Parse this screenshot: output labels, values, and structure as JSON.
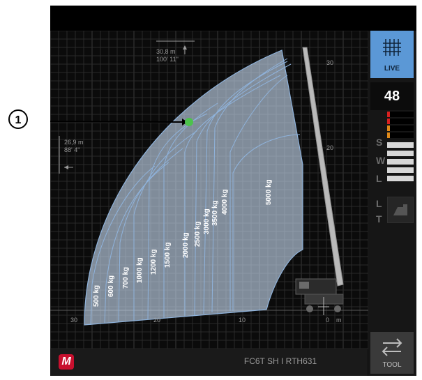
{
  "callout": {
    "number": "1"
  },
  "top_dim": {
    "metric": "30,8 m",
    "imperial": "100' 11\""
  },
  "side_dim": {
    "metric": "26,9 m",
    "imperial": "88' 4\""
  },
  "axis": {
    "x_labels": [
      "30",
      "20",
      "10",
      "0",
      "m"
    ],
    "y_labels": [
      "30",
      "20"
    ]
  },
  "load_zones": [
    {
      "label": "500 kg",
      "value_kg": 500
    },
    {
      "label": "600 kg",
      "value_kg": 600
    },
    {
      "label": "700 kg",
      "value_kg": 700
    },
    {
      "label": "1000 kg",
      "value_kg": 1000
    },
    {
      "label": "1200 kg",
      "value_kg": 1200
    },
    {
      "label": "1500 kg",
      "value_kg": 1500
    },
    {
      "label": "2000 kg",
      "value_kg": 2000
    },
    {
      "label": "2500 kg",
      "value_kg": 2500
    },
    {
      "label": "3000 kg",
      "value_kg": 3000
    },
    {
      "label": "3500 kg",
      "value_kg": 3500
    },
    {
      "label": "4000 kg",
      "value_kg": 4000
    },
    {
      "label": "5000 kg",
      "value_kg": 5000
    }
  ],
  "sidebar": {
    "live_label": "LIVE",
    "count_value": "48",
    "indicator_letters": [
      "S",
      "W",
      "L"
    ],
    "lt_letters": [
      "L",
      "T"
    ],
    "tool_label": "TOOL"
  },
  "footer": {
    "model": "FC6T SH I RTH631",
    "logo_letter": "M"
  },
  "colors": {
    "zone_fill": "#c8dcf2",
    "zone_stroke": "#8fb3dc",
    "accent_blue": "#5b98d6",
    "marker": "#4cc24c",
    "logo": "#c8102e"
  }
}
